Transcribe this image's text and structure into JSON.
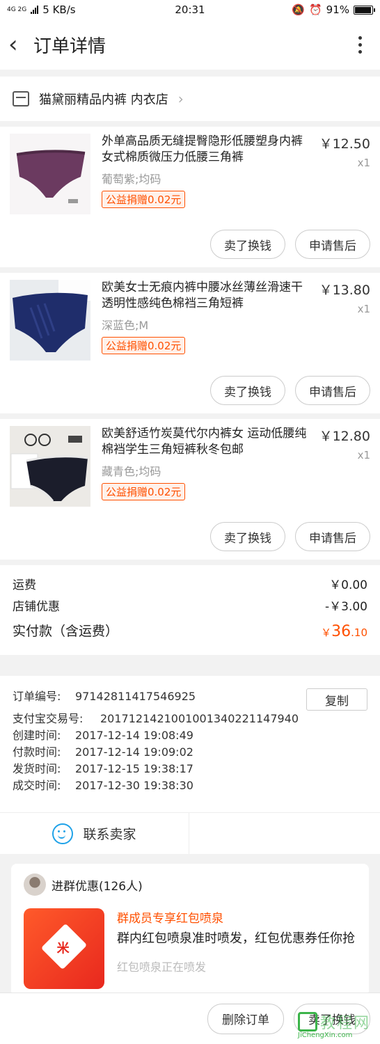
{
  "status_bar": {
    "network": "4G 2G",
    "speed": "5 KB/s",
    "time": "20:31",
    "battery": "91%"
  },
  "nav": {
    "title": "订单详情"
  },
  "shop": {
    "name": "猫黛丽精品内裤 内衣店"
  },
  "items": [
    {
      "name": "外单高品质无缝提臀隐形低腰塑身内裤 女式棉质微压力低腰三角裤",
      "sku": "葡萄紫;均码",
      "tag": "公益捐赠0.02元",
      "price": "￥12.50",
      "qty": "x1",
      "btn1": "卖了换钱",
      "btn2": "申请售后"
    },
    {
      "name": "欧美女士无痕内裤中腰冰丝薄丝滑速干透明性感纯色棉裆三角短裤",
      "sku": "深蓝色;M",
      "tag": "公益捐赠0.02元",
      "price": "￥13.80",
      "qty": "x1",
      "btn1": "卖了换钱",
      "btn2": "申请售后"
    },
    {
      "name": "欧美舒适竹炭莫代尔内裤女 运动低腰纯棉裆学生三角短裤秋冬包邮",
      "sku": "藏青色;均码",
      "tag": "公益捐赠0.02元",
      "price": "￥12.80",
      "qty": "x1",
      "btn1": "卖了换钱",
      "btn2": "申请售后"
    }
  ],
  "summary": {
    "shipping_label": "运费",
    "shipping_value": "￥0.00",
    "discount_label": "店铺优惠",
    "discount_value": "-￥3.00",
    "total_label": "实付款（含运费）",
    "total_currency": "￥",
    "total_int": "36",
    "total_dec": ".10"
  },
  "order_meta": {
    "order_no_label": "订单编号:",
    "order_no": "97142811417546925",
    "alipay_label": "支付宝交易号:",
    "alipay_no": "2017121421001001340221147940",
    "created_label": "创建时间:",
    "created": "2017-12-14 19:08:49",
    "paid_label": "付款时间:",
    "paid": "2017-12-14 19:09:02",
    "shipped_label": "发货时间:",
    "shipped": "2017-12-15 19:38:17",
    "closed_label": "成交时间:",
    "closed": "2017-12-30 19:38:30",
    "copy_label": "复制"
  },
  "contact": {
    "label": "联系卖家"
  },
  "group": {
    "title": "进群优惠(126人)",
    "headline": "群成员专享红包喷泉",
    "desc": "群内红包喷泉准时喷发，红包优惠券任你抢",
    "sub": "红包喷泉正在喷发",
    "icon_text": "米"
  },
  "bottom": {
    "delete_label": "删除订单",
    "sell_label": "卖了换钱"
  },
  "watermark": {
    "cn": "教程网",
    "en": "JiChengXin.com"
  },
  "colors": {
    "accent": "#ff5000",
    "contact_blue": "#1fa2e8"
  }
}
